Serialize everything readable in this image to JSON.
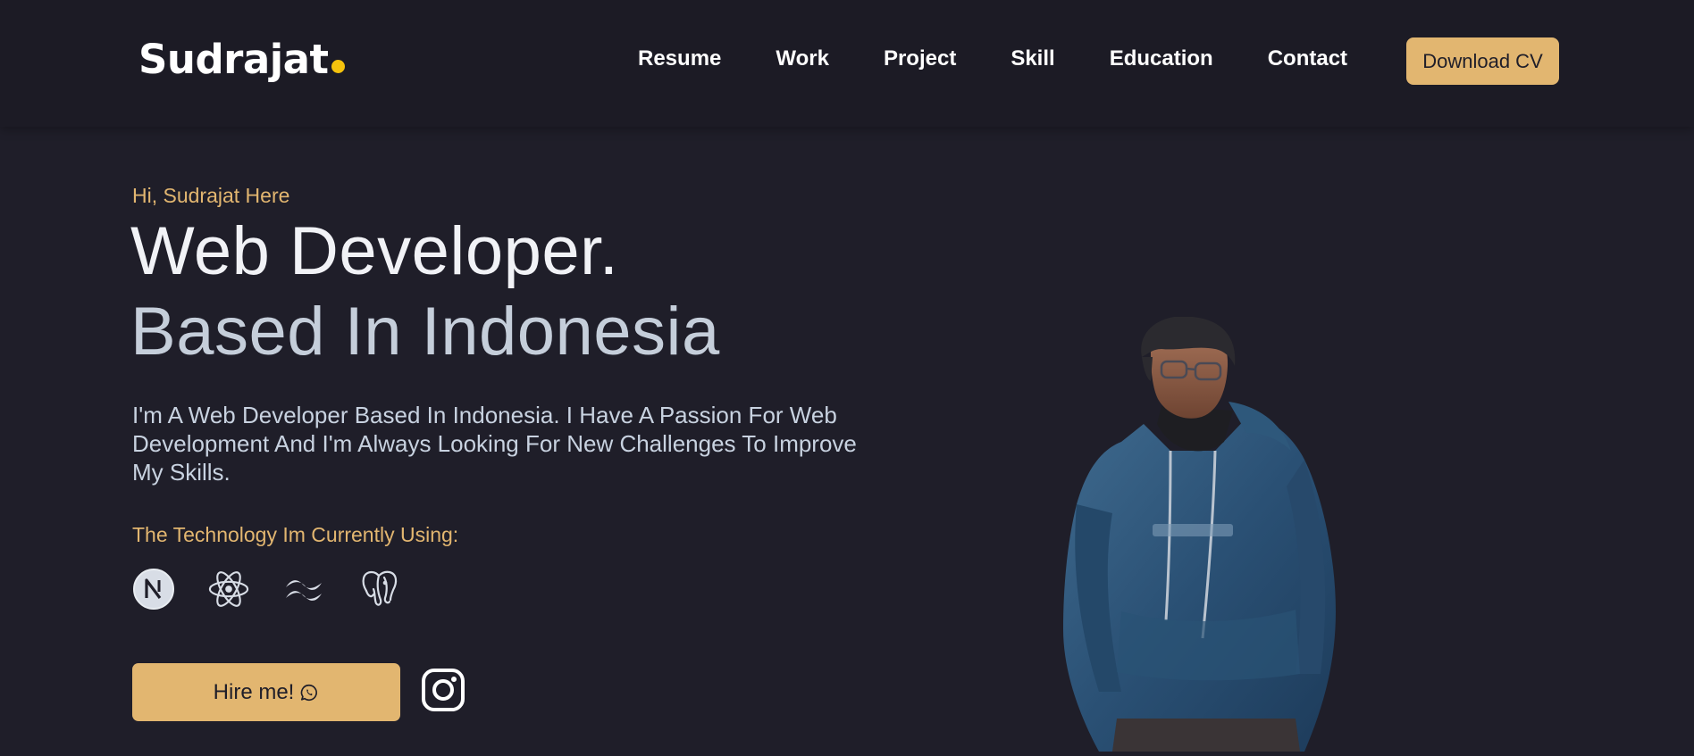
{
  "header": {
    "logo": "Sudrajat",
    "nav": [
      "Resume",
      "Work",
      "Project",
      "Skill",
      "Education",
      "Contact"
    ],
    "download_cv": "Download CV"
  },
  "hero": {
    "greeting": "Hi, Sudrajat Here",
    "headline_1": "Web Developer.",
    "headline_2": "Based In Indonesia",
    "description": "I'm A Web Developer Based In Indonesia. I Have A Passion For Web Development And I'm Always Looking For New Challenges To Improve My Skills.",
    "tech_title": "The Technology Im Currently Using:",
    "tech_icons": [
      "nextjs-icon",
      "react-icon",
      "tailwind-icon",
      "postgresql-icon"
    ],
    "hire_label": "Hire me!",
    "hire_icon": "whatsapp-icon",
    "social_icon": "instagram-icon"
  },
  "colors": {
    "background": "#1f1e29",
    "header_background": "#1c1b25",
    "accent": "#e2b670",
    "logo_dot": "#f4c20d",
    "headline_primary": "#f1f2f6",
    "headline_secondary": "#c5ceda"
  }
}
